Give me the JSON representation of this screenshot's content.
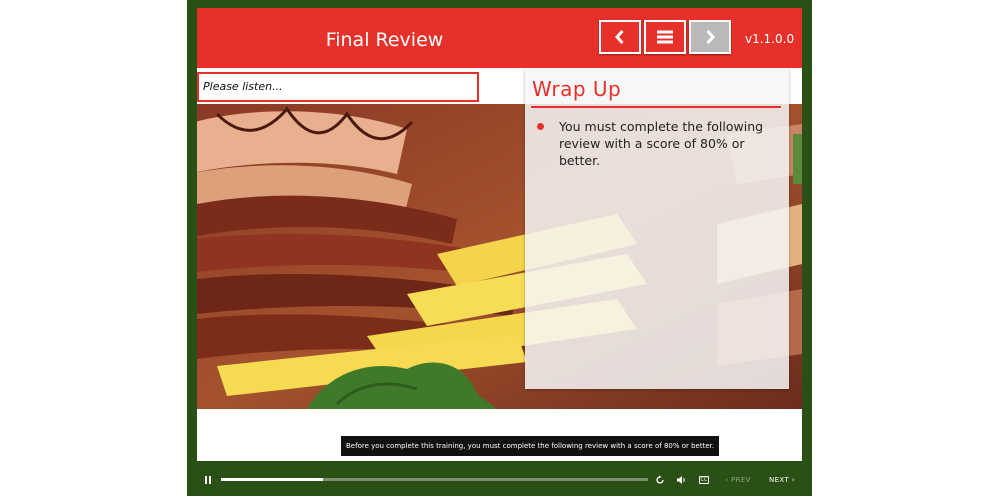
{
  "header": {
    "title": "Final Review",
    "version": "v1.1.0.0",
    "prev_icon": "chevron-left-icon",
    "menu_icon": "menu-icon",
    "next_icon": "chevron-right-icon"
  },
  "status": {
    "listen_text": "Please listen..."
  },
  "panel": {
    "title": "Wrap Up",
    "bullets": [
      "You must complete the following review with a score of 80% or better."
    ]
  },
  "caption": "Before you complete this training, you must complete the following review with a score of 80% or better.",
  "controls": {
    "pause_icon": "pause-icon",
    "reload_icon": "reload-icon",
    "volume_icon": "volume-icon",
    "cc_label": "CC",
    "prev_label": "PREV",
    "next_label": "NEXT",
    "progress": 0.24
  },
  "colors": {
    "frame": "#2b5016",
    "brand_red": "#e8302a",
    "disabled_grey": "#b9b9b9"
  }
}
